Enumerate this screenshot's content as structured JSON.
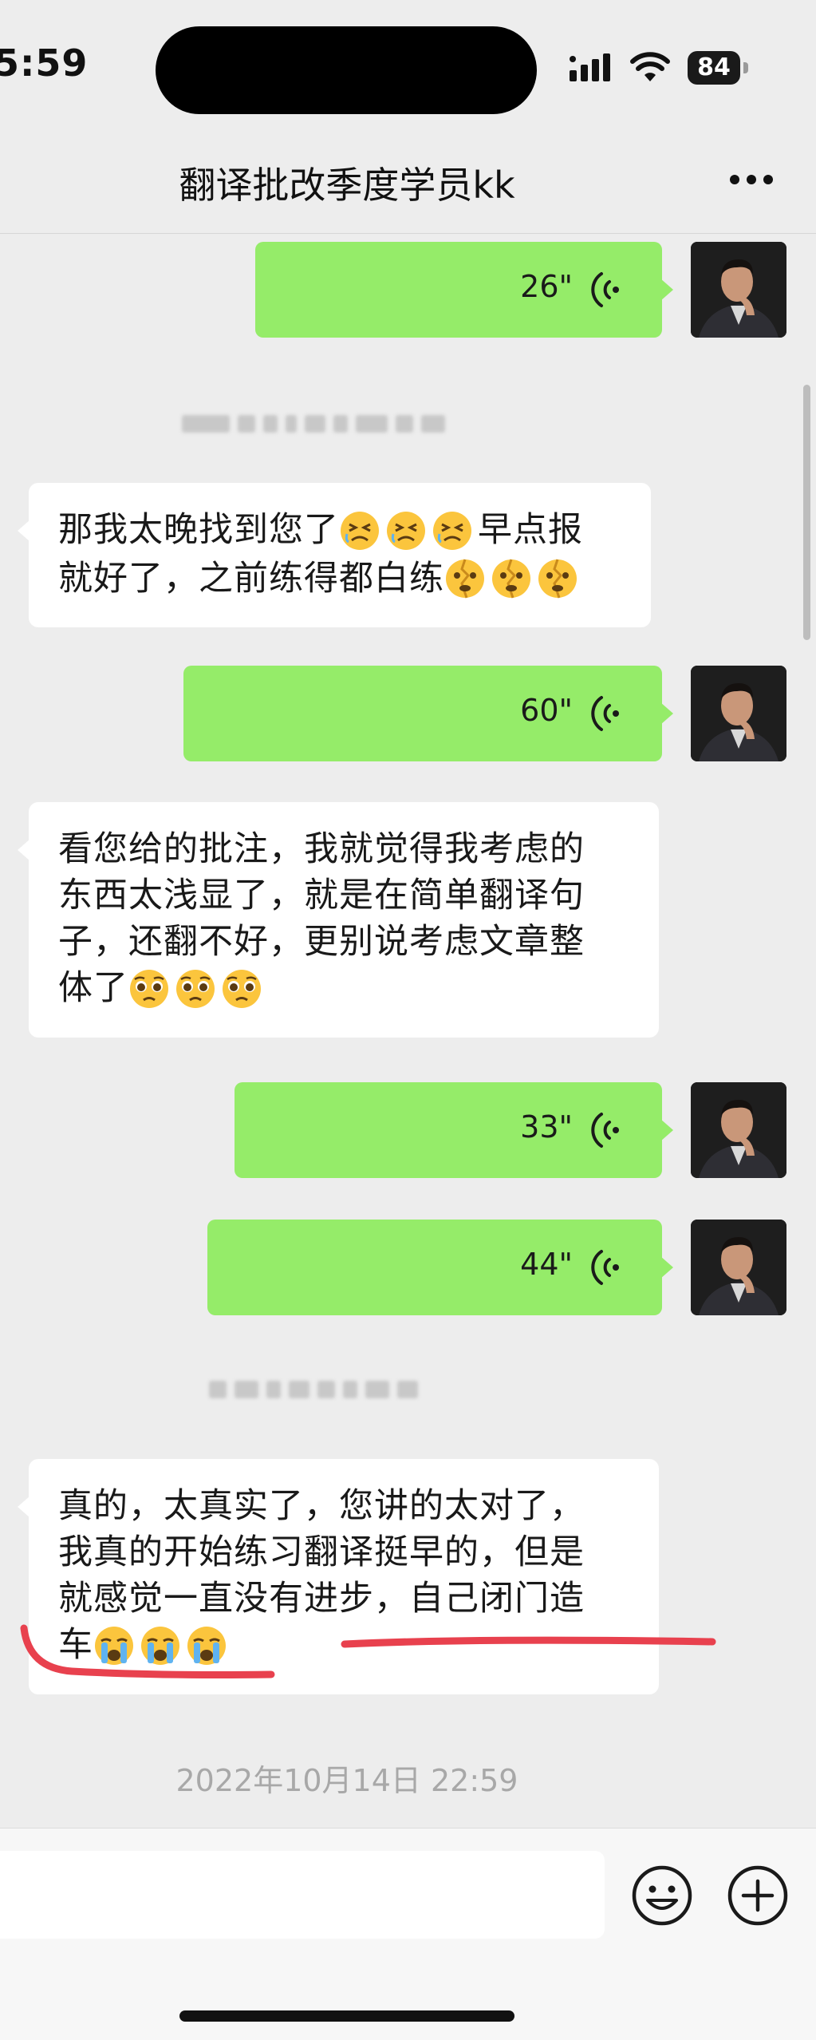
{
  "status_bar": {
    "time": "5:59",
    "battery": "84"
  },
  "nav": {
    "title": "翻译批改季度学员kk"
  },
  "messages": {
    "voice": [
      {
        "duration": "26\""
      },
      {
        "duration": "60\""
      },
      {
        "duration": "33\""
      },
      {
        "duration": "44\""
      }
    ],
    "text": [
      {
        "lines": [
          "那我太晚找到您了",
          "早点报",
          "就好了，之前练得都白练"
        ]
      },
      {
        "lines": [
          "看您给的批注，我就觉得我考虑的",
          "东西太浅显了，就是在简单翻译句",
          "子，还翻不好，更别说考虑文章整",
          "体了"
        ]
      },
      {
        "lines": [
          "真的，太真实了，您讲的太对了，",
          "我真的开始练习翻译挺早的，但是",
          "就感觉一直没有进步，自己闭门造",
          "车"
        ]
      }
    ]
  },
  "timestamp": "2022年10月14日 22:59",
  "colors": {
    "sent_bubble": "#95ec69",
    "received_bubble": "#ffffff",
    "background": "#ededed",
    "pen_mark": "#e8414e"
  }
}
